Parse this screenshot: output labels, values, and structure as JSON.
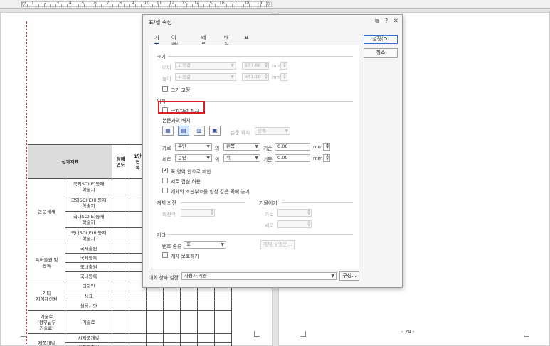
{
  "ruler": {
    "numbers": [
      "1",
      "2",
      "3",
      "4",
      "5",
      "6",
      "7",
      "8",
      "9",
      "10",
      "11",
      "12",
      "13",
      "14",
      "15",
      "16",
      "17",
      "18",
      "19"
    ]
  },
  "document": {
    "header_label": "성과지표",
    "header_cols": [
      "당해\n연도",
      "1단\n연\n목"
    ],
    "groups": [
      {
        "name": "논문게재",
        "items": [
          "국외SCI(E)등재\n학술지",
          "국외SCI(E)비등재\n학술지",
          "국내SCI(E)등재\n학술지",
          "국내SCI(E)비등재\n학술지"
        ]
      },
      {
        "name": "특허출원 및\n등록",
        "items": [
          "국제출원",
          "국제등록",
          "국내출원",
          "국내등록"
        ]
      },
      {
        "name": "기타\n지식재산권",
        "items": [
          "디자인",
          "상표",
          "실용신안"
        ]
      },
      {
        "name": "기술료\n(정부납부\n기술료)",
        "items": [
          "기술료"
        ]
      },
      {
        "name": "제품개발",
        "items": [
          "시제품개발",
          "상품화출시"
        ]
      }
    ],
    "page_number": "- 24 -"
  },
  "dialog": {
    "title": "표/셀 속성",
    "controls": {
      "restore": "⧉",
      "help": "?",
      "close": "✕"
    },
    "tabs": [
      "기본",
      "여백/캡션",
      "테두리",
      "배경",
      "표"
    ],
    "size": {
      "title": "크기",
      "width_label": "너비",
      "width_mode": "고정값",
      "width_value": "177.88",
      "height_label": "높이",
      "height_mode": "고정값",
      "height_value": "341.19",
      "unit": "mm",
      "lock_label": "크기 고정"
    },
    "position": {
      "title": "위치",
      "treat_as_char_label": "글자처럼 취급",
      "wrap_title": "본문과의 배치",
      "wrap_options": [
        "square-wrap-icon",
        "top-bottom-wrap-icon",
        "behind-text-icon",
        "in-front-text-icon"
      ],
      "wrap_position_label": "본문 위치",
      "wrap_position_value": "양쪽",
      "horizontal_label": "가로",
      "horizontal_ref": "문단",
      "horizontal_of": "의",
      "horizontal_align": "왼쪽",
      "horizontal_base_label": "기준",
      "horizontal_base_value": "0.00",
      "vertical_label": "세로",
      "vertical_ref": "문단",
      "vertical_of": "의",
      "vertical_align": "위",
      "vertical_base_label": "기준",
      "vertical_base_value": "0.00",
      "unit": "mm",
      "limit_label": "쪽 영역 안으로 제한",
      "overlap_label": "서로 겹침 허용",
      "keep_label": "개체와 조판부호를 항상 같은 쪽에 놓기"
    },
    "rotation": {
      "title": "개체 회전",
      "angle_label": "회전각"
    },
    "skew": {
      "title": "기울이기",
      "h_label": "가로",
      "v_label": "세로"
    },
    "etc": {
      "title": "기타",
      "number_type_label": "번호 종류",
      "number_type_value": "표",
      "protect_label": "개체 보호하기",
      "describe_button": "개체 설명문..."
    },
    "footer": {
      "dialog_setting_label": "대화 상자 설정",
      "dialog_setting_value": "사용자 지정",
      "config_button": "구성..."
    },
    "buttons": {
      "ok": "설정(D)",
      "cancel": "취소"
    }
  }
}
